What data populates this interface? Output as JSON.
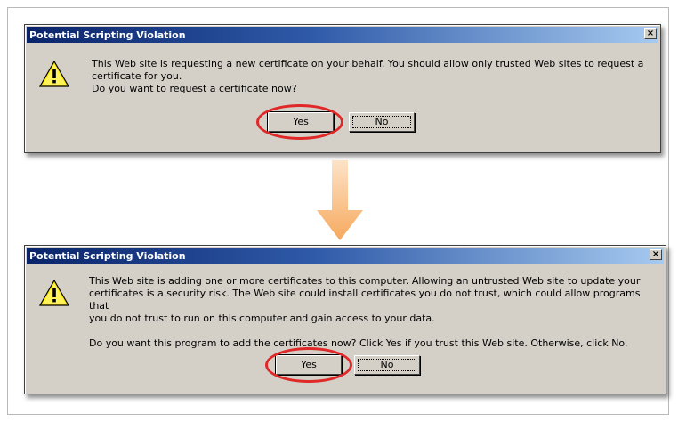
{
  "dialog1": {
    "title": "Potential Scripting Violation",
    "close_glyph": "×",
    "icon": "warning-icon",
    "message_line1": "This Web site is requesting a new certificate on your behalf. You should allow only trusted Web sites to request a",
    "message_line2": "certificate for you.",
    "message_line3": "Do you want to request a certificate now?",
    "yes_label": "Yes",
    "no_label": "No"
  },
  "dialog2": {
    "title": "Potential Scripting Violation",
    "close_glyph": "×",
    "icon": "warning-icon",
    "message_line1": "This Web site is adding one or more certificates to this computer. Allowing an untrusted Web site to update your",
    "message_line2": "certificates is a security risk. The Web site could install certificates you do not trust, which could allow programs that",
    "message_line3": "you do not trust to run on this computer and gain access to your data.",
    "message_line4": "Do you want this program to add the certificates now? Click Yes if you trust this Web site. Otherwise, click No.",
    "yes_label": "Yes",
    "no_label": "No"
  },
  "colors": {
    "dialog_bg": "#d4d0c8",
    "title_start": "#0a246a",
    "title_end": "#a6caf0",
    "highlight": "#e02828",
    "arrow": "#f7b77a"
  }
}
